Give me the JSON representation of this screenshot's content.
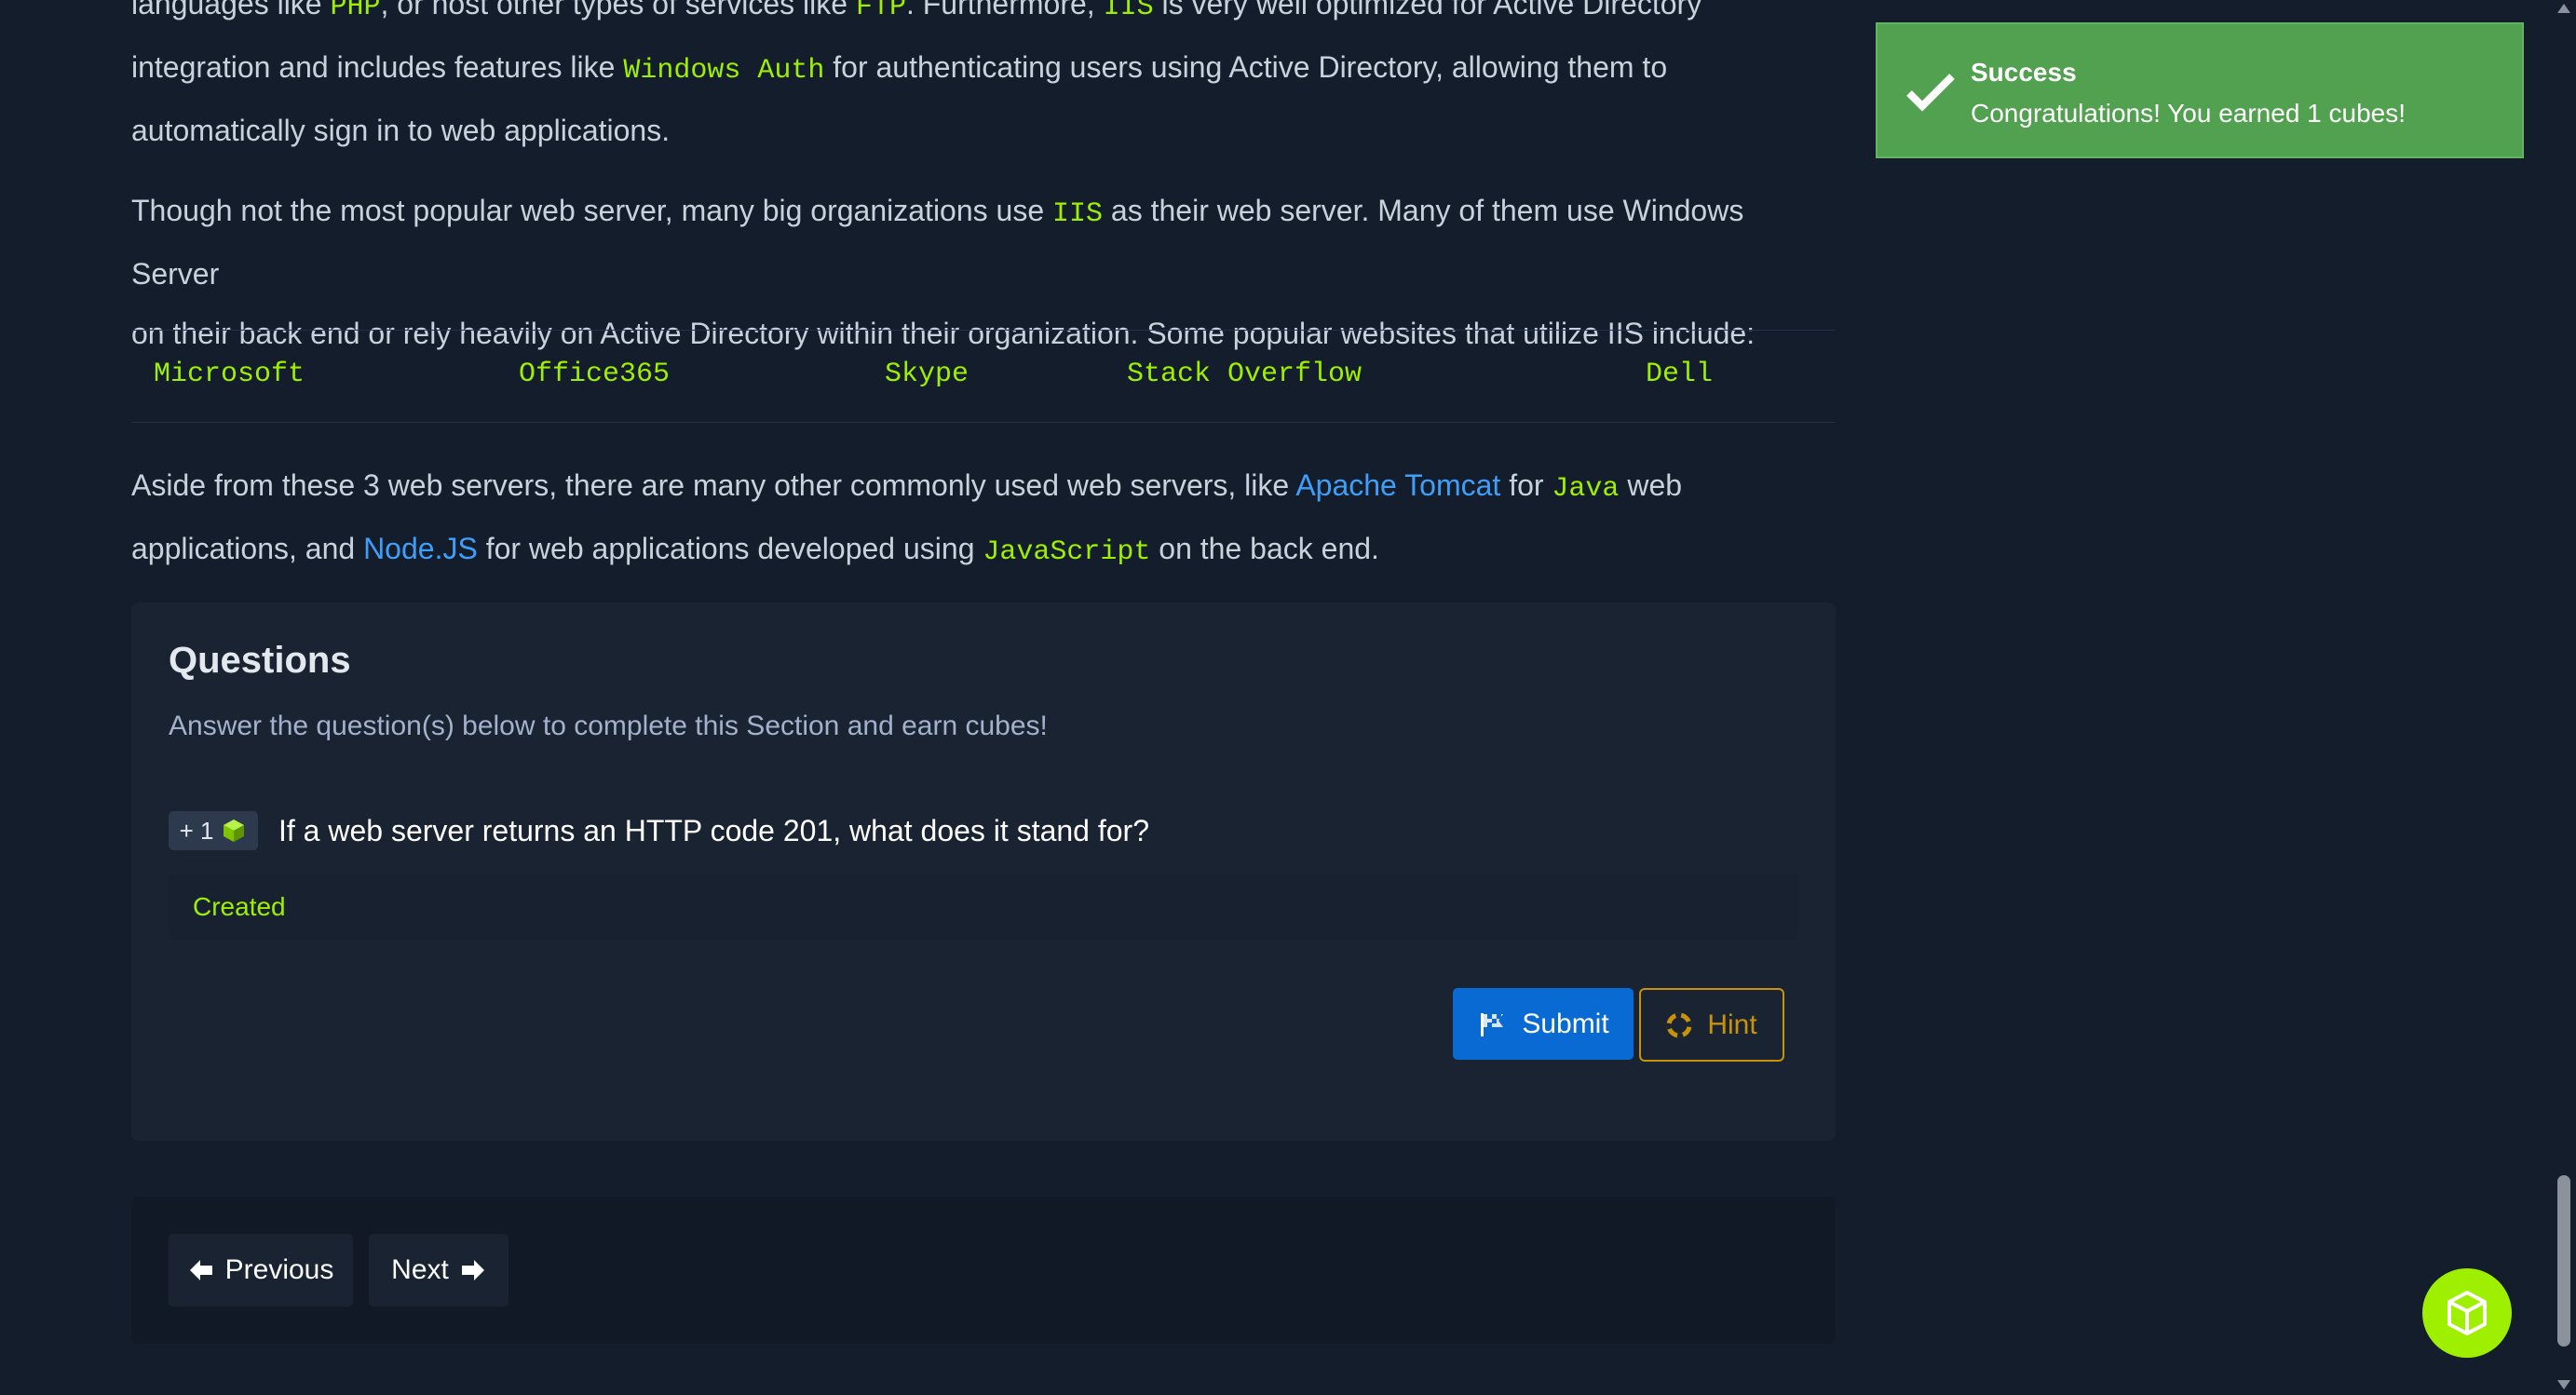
{
  "article": {
    "p1": {
      "line1": [
        "languages like ",
        "PHP",
        ", or host other types of services like ",
        "FTP",
        ". Furthermore, ",
        "IIS",
        " is very well optimized for Active Directory"
      ],
      "line2": [
        "integration and includes features like ",
        "Windows Auth",
        " for authenticating users using Active Directory, allowing them to"
      ],
      "line3": "automatically sign in to web applications."
    },
    "p2": {
      "line1": [
        "Though not the most popular web server, many big organizations use ",
        "IIS",
        " as their web server. Many of them use Windows Server"
      ],
      "line2": "on their back end or rely heavily on Active Directory within their organization. Some popular websites that utilize IIS include:"
    },
    "sites": [
      "Microsoft",
      "Office365",
      "Skype",
      "Stack Overflow",
      "Dell"
    ],
    "p3": {
      "line1": [
        "Aside from these 3 web servers, there are many other commonly used web servers, like ",
        "Apache Tomcat",
        " for ",
        "Java",
        " web"
      ],
      "line2": [
        "applications, and ",
        "Node.JS",
        " for web applications developed using ",
        "JavaScript",
        " on the back end."
      ]
    }
  },
  "questions": {
    "title": "Questions",
    "subtitle": "Answer the question(s) below to complete this Section and earn cubes!",
    "badge": "+ 1",
    "question": "If a web server returns an HTTP code 201, what does it stand for?",
    "answer_value": "Created",
    "submit_label": "Submit",
    "hint_label": "Hint"
  },
  "nav": {
    "previous_label": "Previous",
    "next_label": "Next"
  },
  "toast": {
    "title": "Success",
    "message": "Congratulations! You earned 1 cubes!"
  },
  "icons": {
    "check": "check-icon",
    "cube": "cube-icon",
    "flag": "flag-icon",
    "hint": "lifebuoy-icon",
    "arrow_left": "arrow-left-icon",
    "arrow_right": "arrow-right-icon"
  },
  "colors": {
    "background": "#141d2b",
    "panel": "#1a2332",
    "accent_green": "#9fef00",
    "link_blue": "#3f9ef8",
    "submit_blue": "#0a6ad4",
    "hint_gold": "#c7930a",
    "toast_green": "#51a150"
  }
}
